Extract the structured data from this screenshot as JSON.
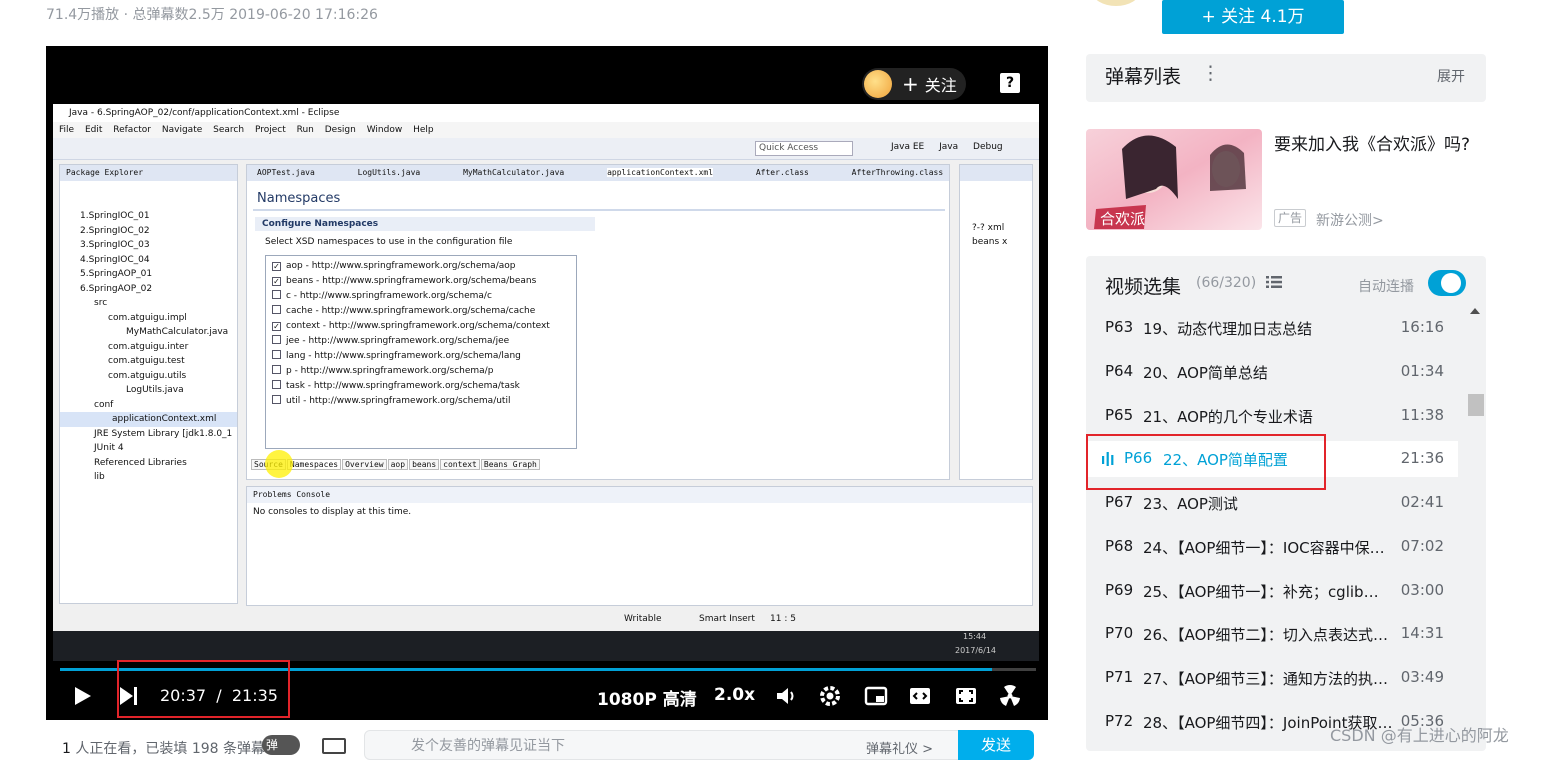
{
  "meta": {
    "text": "71.4万播放 · 总弹幕数2.5万   2019-06-20 17:16:26"
  },
  "player": {
    "follow_overlay": "关注",
    "follow_overlay_plus": "+",
    "report": "?",
    "time": "20:37  /  21:35",
    "progress_fraction": 0.955,
    "quality": "1080P 高清",
    "speed": "2.0x"
  },
  "eclipse": {
    "title": "Java - 6.SpringAOP_02/conf/applicationContext.xml - Eclipse",
    "menu": [
      "File",
      "Edit",
      "Refactor",
      "Navigate",
      "Search",
      "Project",
      "Run",
      "Design",
      "Window",
      "Help"
    ],
    "quick_access": "Quick Access",
    "perspectives": [
      "Java EE",
      "Java",
      "Debug"
    ],
    "package_tab": "Package Explorer",
    "tree": [
      "1.SpringIOC_01",
      "2.SpringIOC_02",
      "3.SpringIOC_03",
      "4.SpringIOC_04",
      "5.SpringAOP_01",
      "6.SpringAOP_02",
      "src",
      "com.atguigu.impl",
      "MyMathCalculator.java",
      "com.atguigu.inter",
      "com.atguigu.test",
      "com.atguigu.utils",
      "LogUtils.java",
      "conf",
      "applicationContext.xml",
      "JRE System Library [jdk1.8.0_1",
      "JUnit 4",
      "Referenced Libraries",
      "lib"
    ],
    "editor_tabs": [
      "AOPTest.java",
      "LogUtils.java",
      "MyMathCalculator.java",
      "applicationContext.xml",
      "After.class",
      "AfterThrowing.class"
    ],
    "ns_title": "Namespaces",
    "configure": "Configure Namespaces",
    "configure_sub": "Select XSD namespaces to use in the configuration file",
    "namespaces": [
      {
        "text": "aop - http://www.springframework.org/schema/aop",
        "checked": true
      },
      {
        "text": "beans - http://www.springframework.org/schema/beans",
        "checked": true
      },
      {
        "text": "c - http://www.springframework.org/schema/c",
        "checked": false
      },
      {
        "text": "cache - http://www.springframework.org/schema/cache",
        "checked": false
      },
      {
        "text": "context - http://www.springframework.org/schema/context",
        "checked": true
      },
      {
        "text": "jee - http://www.springframework.org/schema/jee",
        "checked": false
      },
      {
        "text": "lang - http://www.springframework.org/schema/lang",
        "checked": false
      },
      {
        "text": "p - http://www.springframework.org/schema/p",
        "checked": false
      },
      {
        "text": "task - http://www.springframework.org/schema/task",
        "checked": false
      },
      {
        "text": "util - http://www.springframework.org/schema/util",
        "checked": false
      }
    ],
    "bottom_tabs": [
      "Source",
      "Namespaces",
      "Overview",
      "aop",
      "beans",
      "context",
      "Beans Graph"
    ],
    "console_tabs": "Problems  Console",
    "console_msg": "No consoles to display at this time.",
    "outline": [
      "?-? xml",
      "beans x"
    ],
    "status": {
      "writable": "Writable",
      "insert": "Smart Insert",
      "pos": "11 : 5"
    },
    "taskbar_time": "15:44",
    "taskbar_date": "2017/6/14"
  },
  "bottom": {
    "stats_count": "1",
    "stats_text": "人正在看，已装填 198 条弹幕",
    "dm_toggle": "弹",
    "input_placeholder": "发个友善的弹幕见证当下",
    "etiquette": "弹幕礼仪 >",
    "send": "发送"
  },
  "right": {
    "follow_main": "+  关注 4.1万",
    "danmu_list_title": "弹幕列表",
    "danmu_list_dots": "⋮",
    "danmu_list_expand": "展开",
    "ad": {
      "title": "要来加入我《合欢派》吗?",
      "tag": "广告",
      "link": "新游公测>",
      "image_text": "合欢派"
    },
    "playlist": {
      "title": "视频选集",
      "count": "(66/320)",
      "autoplay": "自动连播",
      "autoplay_on": true,
      "episodes": [
        {
          "num": "P63",
          "title": "19、动态代理加日志总结",
          "dur": "16:16",
          "active": false
        },
        {
          "num": "P64",
          "title": "20、AOP简单总结",
          "dur": "01:34",
          "active": false
        },
        {
          "num": "P65",
          "title": "21、AOP的几个专业术语",
          "dur": "11:38",
          "active": false
        },
        {
          "num": "P66",
          "title": "22、AOP简单配置",
          "dur": "21:36",
          "active": true
        },
        {
          "num": "P67",
          "title": "23、AOP测试",
          "dur": "02:41",
          "active": false
        },
        {
          "num": "P68",
          "title": "24、【AOP细节一】：IOC容器中保…",
          "dur": "07:02",
          "active": false
        },
        {
          "num": "P69",
          "title": "25、【AOP细节一】：补充；cglib为…",
          "dur": "03:00",
          "active": false
        },
        {
          "num": "P70",
          "title": "26、【AOP细节二】：切入点表达式…",
          "dur": "14:31",
          "active": false
        },
        {
          "num": "P71",
          "title": "27、【AOP细节三】：通知方法的执…",
          "dur": "03:49",
          "active": false
        },
        {
          "num": "P72",
          "title": "28、【AOP细节四】：JoinPoint获取…",
          "dur": "05:36",
          "active": false
        }
      ]
    }
  },
  "watermark": "CSDN @有上进心的阿龙",
  "colors": {
    "accent": "#00a1d6",
    "highlight_box": "#e2242a"
  }
}
